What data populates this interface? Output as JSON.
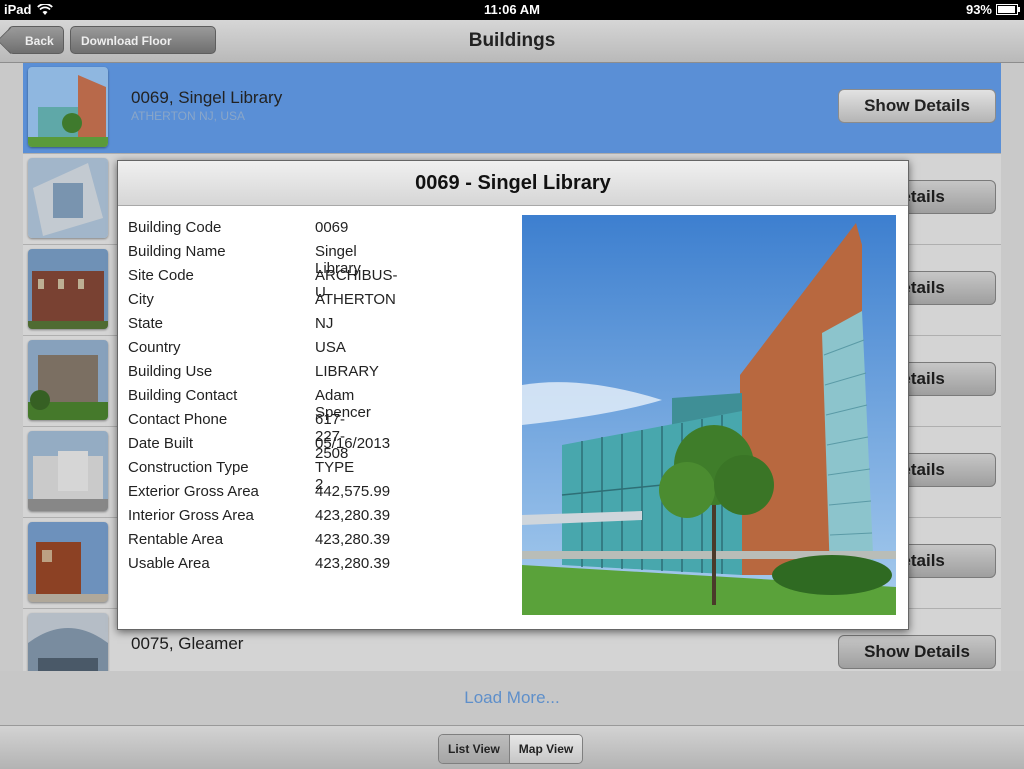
{
  "status_bar": {
    "device": "iPad",
    "time": "11:06 AM",
    "battery_percent": "93%",
    "battery_level": 0.93
  },
  "nav": {
    "title": "Buildings",
    "back_label": "Back",
    "download_label": "Download Floor Plans"
  },
  "list": {
    "rows": [
      {
        "name": "0069, Singel Library",
        "location": "ATHERTON NJ, USA",
        "button": "Show Details",
        "selected": true
      },
      {
        "name": "",
        "location": "",
        "button": "Details"
      },
      {
        "name": "",
        "location": "",
        "button": "Details"
      },
      {
        "name": "",
        "location": "",
        "button": "Details"
      },
      {
        "name": "",
        "location": "",
        "button": "Details"
      },
      {
        "name": "",
        "location": "",
        "button": "Details"
      },
      {
        "name": "0075, Gleamer",
        "location": "",
        "button": "Show Details"
      }
    ]
  },
  "load_more": "Load More...",
  "toolbar": {
    "list_view": "List View",
    "map_view": "Map View"
  },
  "popup": {
    "title": "0069 - Singel Library",
    "fields": [
      {
        "label": "Building Code",
        "value": "0069"
      },
      {
        "label": "Building Name",
        "value": "Singel Library"
      },
      {
        "label": "Site Code",
        "value": "ARCHIBUS-U"
      },
      {
        "label": "City",
        "value": "ATHERTON"
      },
      {
        "label": "State",
        "value": "NJ"
      },
      {
        "label": "Country",
        "value": "USA"
      },
      {
        "label": "Building Use",
        "value": "LIBRARY"
      },
      {
        "label": "Building Contact",
        "value": "Adam Spencer"
      },
      {
        "label": "Contact Phone",
        "value": "617-227-2508"
      },
      {
        "label": "Date Built",
        "value": "05/16/2013"
      },
      {
        "label": "Construction Type",
        "value": "TYPE 2"
      },
      {
        "label": "Exterior Gross Area",
        "value": "442,575.99"
      },
      {
        "label": "Interior Gross Area",
        "value": "423,280.39"
      },
      {
        "label": "Rentable Area",
        "value": "423,280.39"
      },
      {
        "label": "Usable Area",
        "value": "423,280.39"
      }
    ]
  },
  "colors": {
    "selected_row": "#5a8fd6",
    "link": "#5e8fca"
  }
}
